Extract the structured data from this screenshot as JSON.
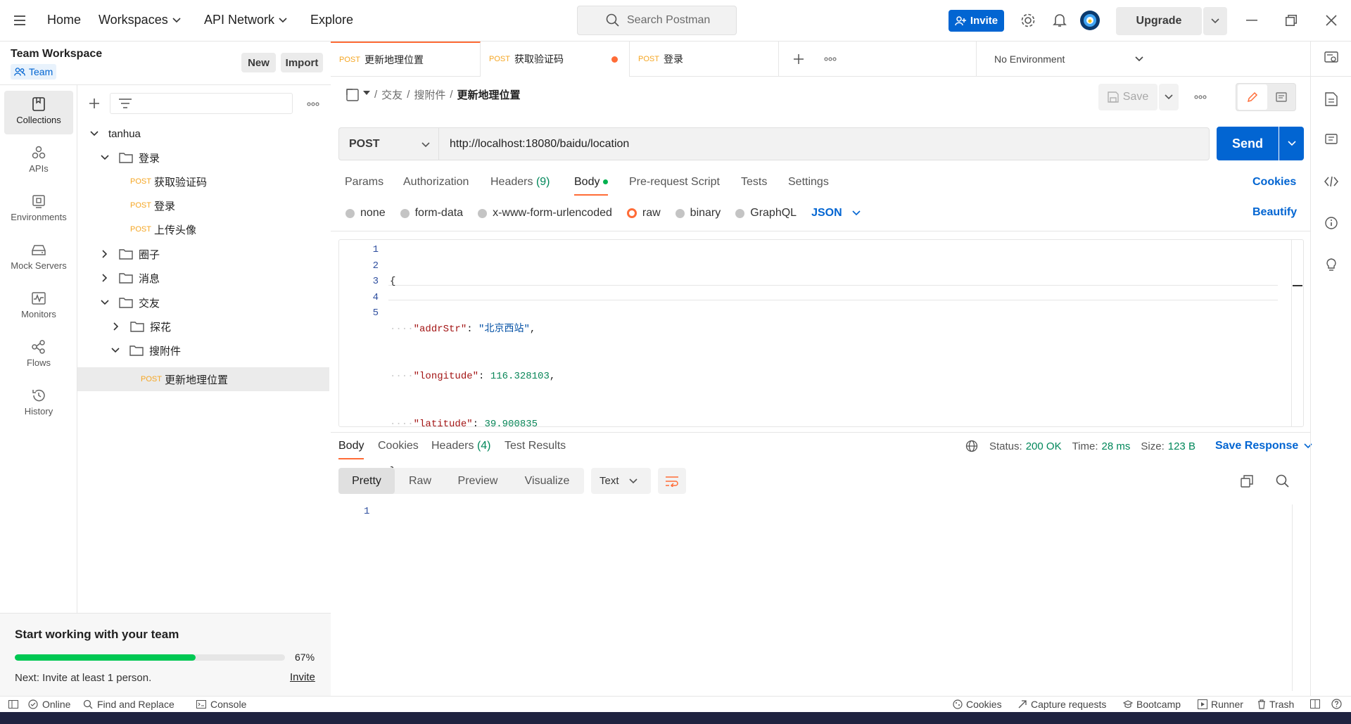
{
  "topbar": {
    "home": "Home",
    "workspaces": "Workspaces",
    "api_network": "API Network",
    "explore": "Explore",
    "search_placeholder": "Search Postman",
    "invite": "Invite",
    "upgrade": "Upgrade"
  },
  "workspace": {
    "name": "Team Workspace",
    "badge": "Team",
    "new_label": "New",
    "import_label": "Import"
  },
  "rail": [
    {
      "label": "Collections",
      "icon": "collections-icon"
    },
    {
      "label": "APIs",
      "icon": "apis-icon"
    },
    {
      "label": "Environments",
      "icon": "environments-icon"
    },
    {
      "label": "Mock Servers",
      "icon": "mock-servers-icon"
    },
    {
      "label": "Monitors",
      "icon": "monitors-icon"
    },
    {
      "label": "Flows",
      "icon": "flows-icon"
    },
    {
      "label": "History",
      "icon": "history-icon"
    }
  ],
  "tree": {
    "collection": "tanhua",
    "folder_login": "登录",
    "req_code": "获取验证码",
    "req_login": "登录",
    "req_avatar": "上传头像",
    "folder_circle": "圈子",
    "folder_msg": "消息",
    "folder_friends": "交友",
    "folder_tanhua": "探花",
    "folder_attach": "搜附件",
    "req_location": "更新地理位置",
    "method": "POST"
  },
  "team_card": {
    "title": "Start working with your team",
    "progress": 67,
    "progress_label": "67%",
    "next": "Next: Invite at least 1 person.",
    "invite": "Invite"
  },
  "tabs": [
    {
      "method": "POST",
      "title": "更新地理位置"
    },
    {
      "method": "POST",
      "title": "获取验证码"
    },
    {
      "method": "POST",
      "title": "登录"
    }
  ],
  "environment": "No Environment",
  "breadcrumb": {
    "part1": "交友",
    "part2": "搜附件",
    "current": "更新地理位置",
    "sep": "/"
  },
  "save_label": "Save",
  "request": {
    "method": "POST",
    "url": "http://localhost:18080/baidu/location",
    "send": "Send"
  },
  "req_tabs": {
    "params": "Params",
    "authorization": "Authorization",
    "headers": "Headers",
    "headers_count": "(9)",
    "body": "Body",
    "prerequest": "Pre-request Script",
    "tests": "Tests",
    "settings": "Settings",
    "cookies": "Cookies"
  },
  "body_types": {
    "none": "none",
    "form_data": "form-data",
    "urlencoded": "x-www-form-urlencoded",
    "raw": "raw",
    "binary": "binary",
    "graphql": "GraphQL",
    "json": "JSON",
    "beautify": "Beautify"
  },
  "code": {
    "line_numbers": [
      "1",
      "2",
      "3",
      "4",
      "5"
    ],
    "brace_open": "{",
    "brace_close": "}",
    "k1": "\"addrStr\"",
    "v1": "\"北京西站\"",
    "k2": "\"longitude\"",
    "v2": "116.328103",
    "k3": "\"latitude\"",
    "v3": "39.900835",
    "colon": ": ",
    "comma": ","
  },
  "response": {
    "tab_body": "Body",
    "tab_cookies": "Cookies",
    "tab_headers": "Headers",
    "headers_count": "(4)",
    "tab_tests": "Test Results",
    "status_label": "Status:",
    "status": "200 OK",
    "time_label": "Time:",
    "time": "28 ms",
    "size_label": "Size:",
    "size": "123 B",
    "save_response": "Save Response",
    "view_pretty": "Pretty",
    "view_raw": "Raw",
    "view_preview": "Preview",
    "view_visualize": "Visualize",
    "format": "Text",
    "line1": "1"
  },
  "statusbar": {
    "online": "Online",
    "find_replace": "Find and Replace",
    "console": "Console",
    "cookies": "Cookies",
    "capture": "Capture requests",
    "bootcamp": "Bootcamp",
    "runner": "Runner",
    "trash": "Trash"
  },
  "colors": {
    "accent": "#ff6c37",
    "brand_blue": "#0265d2",
    "success": "#00875a",
    "post": "#f5a623",
    "progress": "#00c853"
  }
}
